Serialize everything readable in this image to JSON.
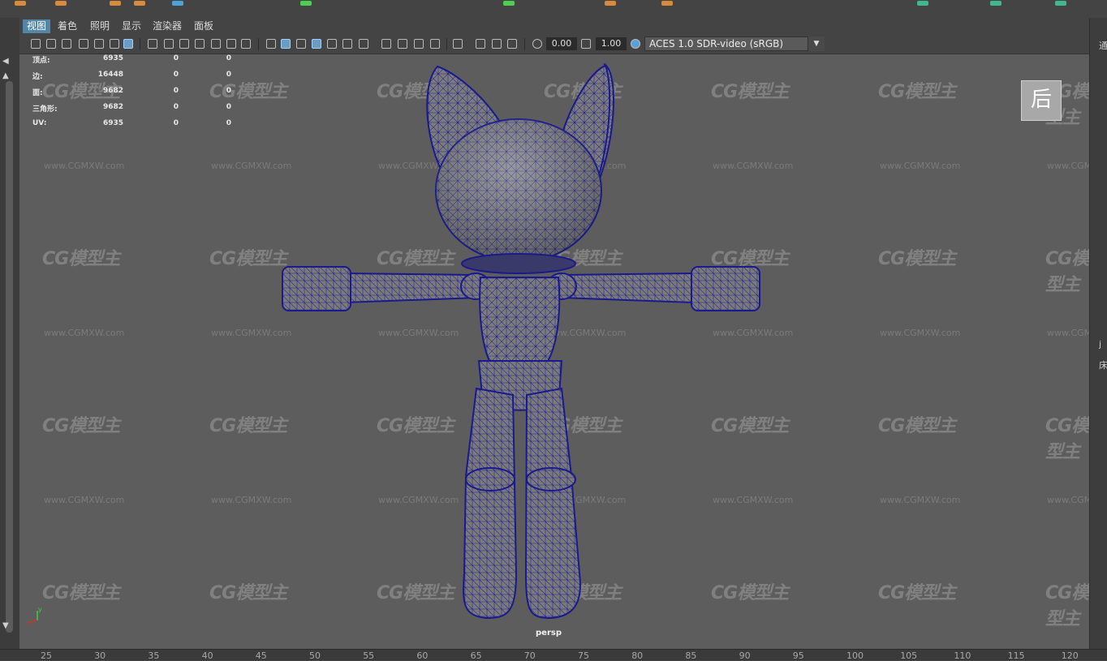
{
  "menu": [
    {
      "label": "视图",
      "active": true
    },
    {
      "label": "着色",
      "active": false
    },
    {
      "label": "照明",
      "active": false
    },
    {
      "label": "显示",
      "active": false
    },
    {
      "label": "渲染器",
      "active": false
    },
    {
      "label": "面板",
      "active": false
    }
  ],
  "toolbar": {
    "exposure_value": "0.00",
    "gamma_value": "1.00",
    "color_space": "ACES 1.0 SDR-video (sRGB)"
  },
  "hud": {
    "rows": [
      {
        "label": "顶点:",
        "v1": "6935",
        "v2": "0",
        "v3": "0"
      },
      {
        "label": "边:",
        "v1": "16448",
        "v2": "0",
        "v3": "0"
      },
      {
        "label": "面:",
        "v1": "9682",
        "v2": "0",
        "v3": "0"
      },
      {
        "label": "三角形:",
        "v1": "9682",
        "v2": "0",
        "v3": "0"
      },
      {
        "label": "UV:",
        "v1": "6935",
        "v2": "0",
        "v3": "0"
      }
    ]
  },
  "viewport": {
    "camera_label": "persp",
    "viewcube_face": "后",
    "axis_y": "y",
    "axis_x": "x"
  },
  "watermark": {
    "logo": "CG模型主",
    "url": "www.CGMXW.com"
  },
  "right_rail": {
    "chars": [
      "通",
      "j",
      "床"
    ]
  },
  "timeline_ticks": [
    "25",
    "30",
    "35",
    "40",
    "45",
    "50",
    "55",
    "60",
    "65",
    "70",
    "75",
    "80",
    "85",
    "90",
    "95",
    "100",
    "105",
    "110",
    "115",
    "120"
  ],
  "colors": {
    "viewport_bg": "#5d5d5d",
    "wire": "#1a1a8c",
    "menu_active": "#5285a6"
  }
}
